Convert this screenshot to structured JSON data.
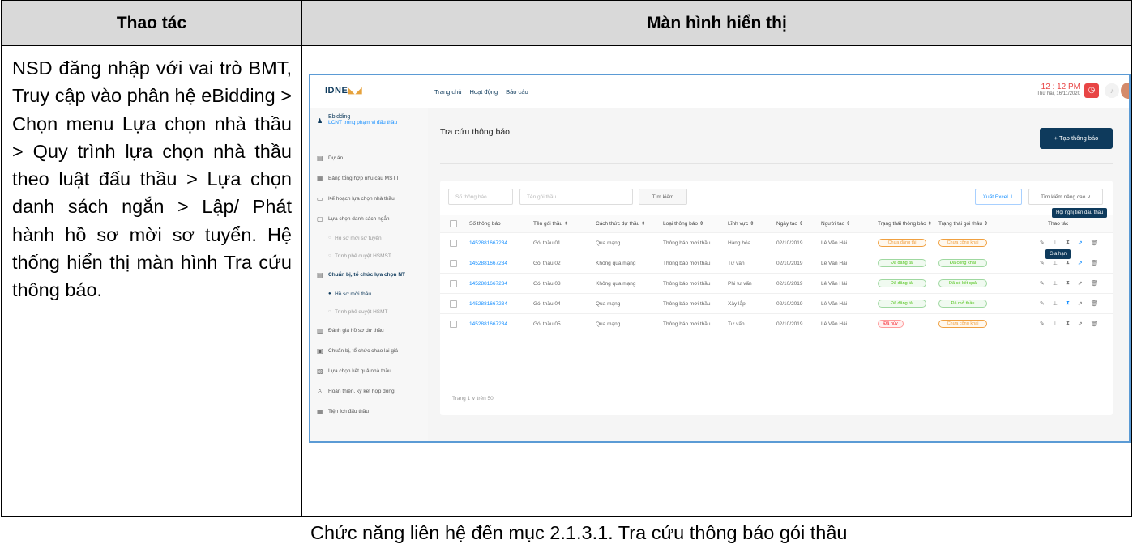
{
  "header": {
    "col1": "Thao tác",
    "col2": "Màn hình hiển thị"
  },
  "instruction": "NSD đăng nhập với vai trò BMT, Truy cập vào phân hệ eBidding > Chọn menu Lựa chọn nhà thầu > Quy trình lựa chọn nhà thầu theo luật đấu thầu > Lựa chọn danh sách ngắn > Lập/ Phát hành hồ sơ mời sơ tuyển. Hệ thống hiển thị màn hình Tra cứu thông báo.",
  "caption": "Chức năng liên hệ đến mục 2.1.3.1. Tra cứu thông báo gói thầu",
  "app": {
    "logo": "IDNE",
    "nav": [
      "Trang chủ",
      "Hoạt động",
      "Báo cáo"
    ],
    "time": "12 : 12 PM",
    "date": "Thứ hai, 16/11/2020",
    "sidebar": {
      "module": "Ebidding",
      "module_link": "LCNT trong phạm vi đấu thầu",
      "items": [
        {
          "icon": "building-icon",
          "glyph": "▤",
          "label": "Dự án"
        },
        {
          "icon": "grid-icon",
          "glyph": "▦",
          "label": "Bảng tổng hợp nhu cầu MSTT"
        },
        {
          "icon": "calendar-icon",
          "glyph": "▭",
          "label": "Kế hoạch lựa chọn nhà thầu"
        },
        {
          "icon": "list-icon",
          "glyph": "▢",
          "label": "Lựa chọn danh sách ngắn"
        },
        {
          "label": "Hồ sơ mời sơ tuyển",
          "sub": true
        },
        {
          "label": "Trình phê duyệt HSMST",
          "sub": true
        },
        {
          "icon": "folder-icon",
          "glyph": "▤",
          "label": "Chuẩn bị, tổ chức lựa chọn NT",
          "active": true
        },
        {
          "label": "Hồ sơ mời thầu",
          "sub": true,
          "active": true
        },
        {
          "label": "Trình phê duyệt HSMT",
          "sub": true
        },
        {
          "icon": "evaluate-icon",
          "glyph": "▥",
          "label": "Đánh giá hồ sơ dự thầu"
        },
        {
          "icon": "doc-icon",
          "glyph": "▣",
          "label": "Chuẩn bị, tổ chức chào lại giá"
        },
        {
          "icon": "result-icon",
          "glyph": "▧",
          "label": "Lựa chọn kết quả nhà thầu"
        },
        {
          "icon": "user-icon",
          "glyph": "♙",
          "label": "Hoàn thiện, ký kết hợp đồng"
        },
        {
          "icon": "table-icon",
          "glyph": "▦",
          "label": "Tiện ích đấu thầu"
        }
      ]
    },
    "page_title": "Tra cứu thông báo",
    "create_button": "+ Tạo thông báo",
    "search": {
      "number_placeholder": "Số thông báo",
      "name_placeholder": "Tên gói thầu",
      "button": "Tìm kiếm"
    },
    "excel_button": "Xuất Excel ⊥",
    "advanced_button": "Tìm kiếm nâng cao ∨",
    "columns": [
      "Số thông báo",
      "Tên gói thầu ⇕",
      "Cách thức dự thầu ⇕",
      "Loại thông báo ⇕",
      "Lĩnh vực ⇕",
      "Ngày tạo ⇕",
      "Người tạo ⇕",
      "Trạng thái thông báo ⇕",
      "Trạng thái gói thầu ⇕",
      "Thao tác"
    ],
    "rows": [
      {
        "number": "1452881667234",
        "name": "Gói thầu 01",
        "method": "Qua mạng",
        "type": "Thông báo mời thầu",
        "field": "Hàng hóa",
        "date": "02/10/2019",
        "creator": "Lê Văn Hải",
        "notice_status": "Chưa đăng tải",
        "notice_color": "orange",
        "package_status": "Chưa công khai",
        "package_color": "orange"
      },
      {
        "number": "1452881667234",
        "name": "Gói thầu 02",
        "method": "Không qua mạng",
        "type": "Thông báo mời thầu",
        "field": "Tư vấn",
        "date": "02/10/2019",
        "creator": "Lê Văn Hải",
        "notice_status": "Đã đăng tải",
        "notice_color": "green",
        "package_status": "Đã công khai",
        "package_color": "green"
      },
      {
        "number": "1452881667234",
        "name": "Gói thầu 03",
        "method": "Không qua mạng",
        "type": "Thông báo mời thầu",
        "field": "Phi tư vấn",
        "date": "02/10/2019",
        "creator": "Lê Văn Hải",
        "notice_status": "Đã đăng tải",
        "notice_color": "green",
        "package_status": "Đã có kết quả",
        "package_color": "green"
      },
      {
        "number": "1452881667234",
        "name": "Gói thầu 04",
        "method": "Qua mạng",
        "type": "Thông báo mời thầu",
        "field": "Xây lắp",
        "date": "02/10/2019",
        "creator": "Lê Văn Hải",
        "notice_status": "Đã đăng tải",
        "notice_color": "green",
        "package_status": "Đã mở thầu",
        "package_color": "green"
      },
      {
        "number": "1452881667234",
        "name": "Gói thầu 05",
        "method": "Qua mạng",
        "type": "Thông báo mời thầu",
        "field": "Tư vấn",
        "date": "02/10/2019",
        "creator": "Lê Văn Hải",
        "notice_status": "Đã hủy",
        "notice_color": "red",
        "package_status": "Chưa công khai",
        "package_color": "orange"
      }
    ],
    "action_icons": [
      "✎",
      "⊥",
      "⧗",
      "⇗",
      "🗑"
    ],
    "tooltip_1": "Hội nghị tiền đấu thầu",
    "tooltip_2": "Gia hạn",
    "pager": "Trang  1  ∨  trên 50",
    "colors": {
      "primary": "#0e3a5c",
      "link": "#1890ff",
      "alarm": "#e84545",
      "frame": "#5b9bd5"
    }
  }
}
